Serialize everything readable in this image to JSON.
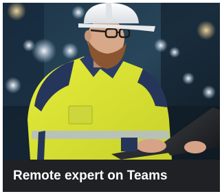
{
  "card": {
    "caption": "Remote expert on Teams",
    "image_subject": "engineer in hard hat and high-visibility jacket using a laptop"
  }
}
